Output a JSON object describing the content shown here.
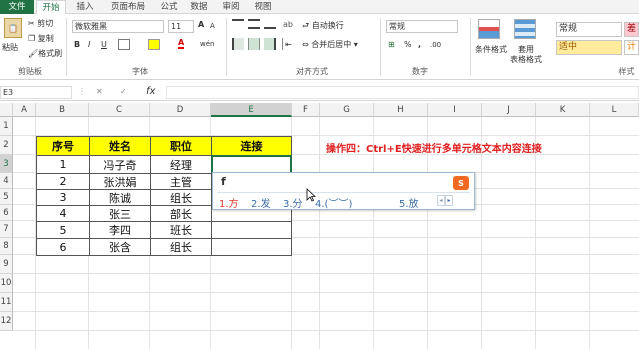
{
  "tabs": [
    "文件",
    "开始",
    "插入",
    "页面布局",
    "公式",
    "数据",
    "审阅",
    "视图"
  ],
  "clipboard": {
    "paste": "粘贴",
    "cut": "剪切",
    "copy": "复制",
    "format_painter": "格式刷",
    "label": "剪贴板"
  },
  "font": {
    "name": "微软雅黑",
    "size": "11",
    "label": "字体",
    "bold": "B",
    "italic": "I",
    "underline": "U",
    "grow": "A",
    "shrink": "A",
    "color_a": "A",
    "wen": "wén"
  },
  "align": {
    "wrap": "自动换行",
    "merge": "合并后居中",
    "label": "对齐方式"
  },
  "number": {
    "format": "常规",
    "label": "数字",
    "percent": "%",
    "comma": ","
  },
  "styles": {
    "cond": "条件格式",
    "table": "套用",
    "table2": "表格格式",
    "normal": "常规",
    "moderate": "适中",
    "bad": "差",
    "calc": "计",
    "label": "样式"
  },
  "formula_bar": {
    "name_box": "E3",
    "cancel": "✕",
    "enter": "✓",
    "fx": "fx"
  },
  "columns": [
    "A",
    "B",
    "C",
    "D",
    "E",
    "F",
    "G",
    "H",
    "I",
    "J",
    "K",
    "L"
  ],
  "rows": [
    "1",
    "2",
    "3",
    "4",
    "5",
    "6",
    "7",
    "8",
    "9",
    "10",
    "11",
    "12"
  ],
  "table": {
    "headers": [
      "序号",
      "姓名",
      "职位",
      "连接"
    ],
    "rows": [
      [
        "1",
        "冯子奇",
        "经理",
        ""
      ],
      [
        "2",
        "张洪娟",
        "主管",
        ""
      ],
      [
        "3",
        "陈诚",
        "组长",
        ""
      ],
      [
        "4",
        "张三",
        "部长",
        ""
      ],
      [
        "5",
        "李四",
        "班长",
        ""
      ],
      [
        "6",
        "张含",
        "组长",
        ""
      ]
    ]
  },
  "note": "操作四：Ctrl+E快速进行多单元格文本内容连接",
  "ime": {
    "input": "f",
    "candidates": [
      "1.方",
      "2.发",
      "3.分",
      "4.(︶︶)",
      "5.放"
    ]
  }
}
